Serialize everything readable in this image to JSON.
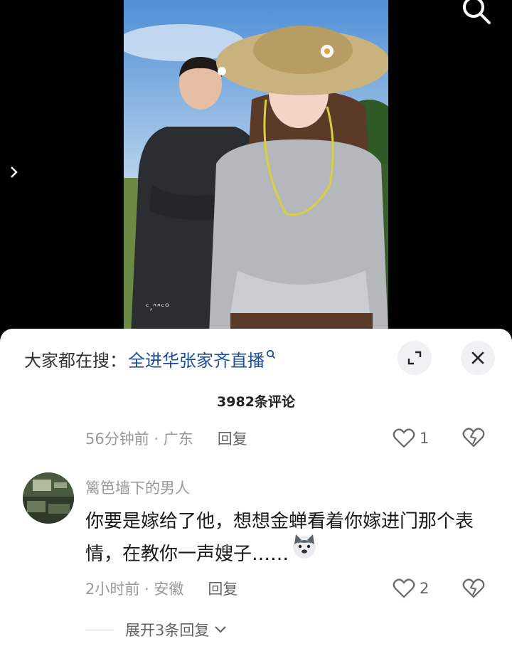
{
  "video": {
    "watermark": "ᶜ,ᐢᐢᶜᴼ",
    "icons": [
      "search-icon",
      "chevron-right-icon"
    ]
  },
  "sheet": {
    "search_prefix": "大家都在搜：",
    "search_term": "全进华张家齐直播",
    "comment_count": "3982条评论"
  },
  "comments": [
    {
      "meta": "56分钟前 · 广东",
      "reply_label": "回复",
      "likes": "1"
    },
    {
      "username": "篱笆墙下的男人",
      "text": "你要是嫁给了他，想想金蝉看着你嫁进门那个表情，在教你一声嫂子……",
      "meta": "2小时前 · 安徽",
      "reply_label": "回复",
      "likes": "2",
      "expand_label": "展开3条回复"
    }
  ],
  "colors": {
    "link_blue": "#1d4e9c",
    "meta_gray": "#999999",
    "sheet_bg": "#ffffff",
    "button_bg": "#f1f1f3"
  }
}
